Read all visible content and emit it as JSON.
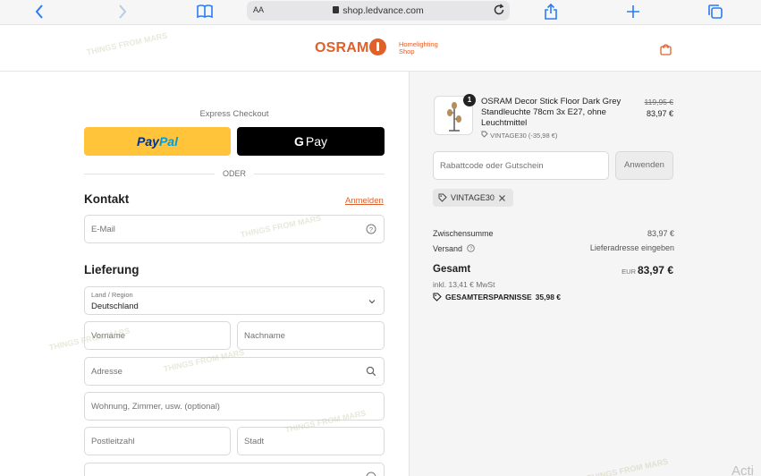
{
  "browser": {
    "aa_label": "AA",
    "url": "shop.ledvance.com"
  },
  "header": {
    "logo_text": "OSRAM",
    "logo_sub_line1": "Homelighting",
    "logo_sub_line2": "Shop"
  },
  "checkout": {
    "express_label": "Express Checkout",
    "paypal_part1": "Pay",
    "paypal_part2": "Pal",
    "gpay_g": "G",
    "gpay_label": "Pay",
    "or_label": "ODER",
    "contact_heading": "Kontakt",
    "login_link": "Anmelden",
    "email_placeholder": "E-Mail",
    "delivery_heading": "Lieferung",
    "country_label": "Land / Region",
    "country_value": "Deutschland",
    "firstname_placeholder": "Vorname",
    "lastname_placeholder": "Nachname",
    "address_placeholder": "Adresse",
    "apartment_placeholder": "Wohnung, Zimmer, usw. (optional)",
    "zip_placeholder": "Postleitzahl",
    "city_placeholder": "Stadt"
  },
  "summary": {
    "product": {
      "quantity": "1",
      "name": "OSRAM Decor Stick Floor Dark Grey Standleuchte 78cm 3x E27, ohne Leuchtmittel",
      "code": "VINTAGE30 (-35,98 €)",
      "price_old": "119,95 €",
      "price_new": "83,97 €"
    },
    "discount_placeholder": "Rabattcode oder Gutschein",
    "apply_label": "Anwenden",
    "coupon_code": "VINTAGE30",
    "subtotal_label": "Zwischensumme",
    "subtotal_value": "83,97 €",
    "shipping_label": "Versand",
    "shipping_value": "Lieferadresse eingeben",
    "total_label": "Gesamt",
    "total_currency": "EUR",
    "total_value": "83,97 €",
    "tax_line": "inkl. 13,41 € MwSt",
    "savings_label": "GESAMTERSPARNISSE",
    "savings_value": "35,98 €"
  },
  "overlay": {
    "watermark": "THINGS FROM MARS",
    "acti_text": "Acti"
  },
  "colors": {
    "brand_orange": "#e0602a",
    "paypal_yellow": "#ffc439",
    "ios_blue": "#2a7cf6"
  }
}
